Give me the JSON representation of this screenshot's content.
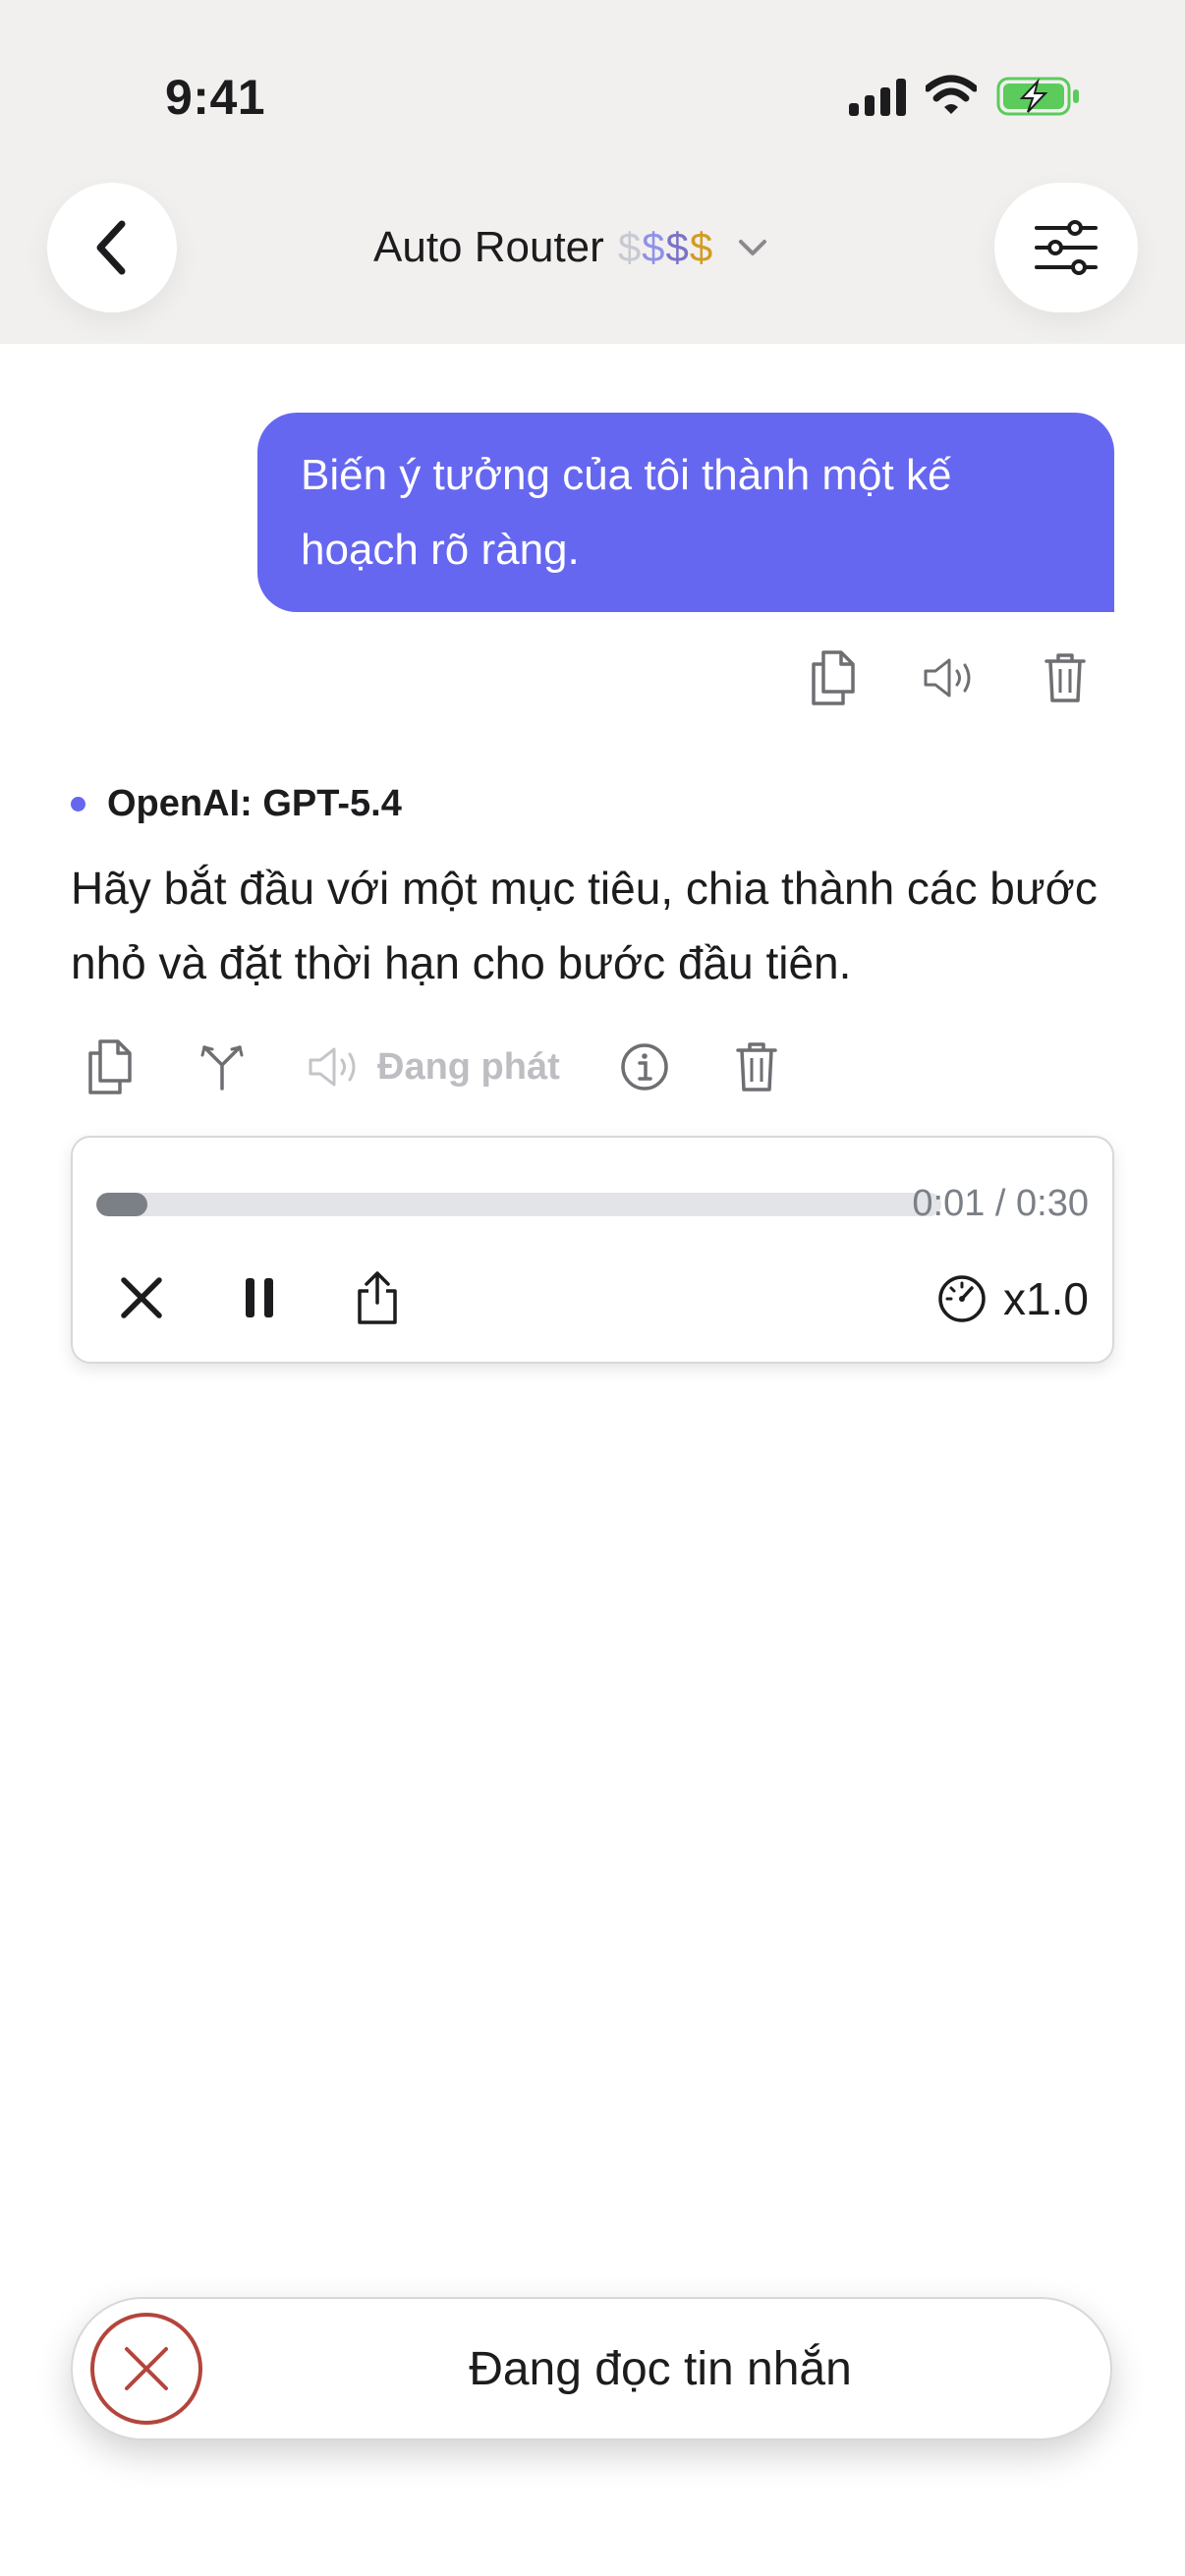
{
  "status_bar": {
    "time": "9:41"
  },
  "header": {
    "model_name": "Auto Router",
    "price_tier": [
      "$",
      "$",
      "$",
      "$"
    ]
  },
  "conversation": {
    "user_message": "Biến ý tưởng của tôi thành một kế hoạch rõ ràng.",
    "assistant": {
      "model_label": "OpenAI: GPT-5.4",
      "text": "Hãy bắt đầu với một mục tiêu, chia thành các bước nhỏ và đặt thời hạn cho bước đầu tiên.",
      "playing_label": "Đang phát"
    }
  },
  "player": {
    "progress": 0.06,
    "time_readout": "0:01 / 0:30",
    "speed": "x1.0"
  },
  "toast": {
    "text": "Đang đọc tin nhắn"
  },
  "icons": {
    "back": "chevron-left-icon",
    "settings": "sliders-icon",
    "copy": "copy-icon",
    "speaker": "speaker-icon",
    "trash": "trash-icon",
    "branch": "branch-icon",
    "info": "info-icon",
    "close": "close-icon",
    "pause": "pause-icon",
    "share": "share-icon",
    "speedometer": "speedometer-icon"
  },
  "colors": {
    "accent": "#6667f0",
    "header_bg": "#f1f0ee",
    "stop": "#b4453c",
    "price_gold": "#d39b22"
  }
}
